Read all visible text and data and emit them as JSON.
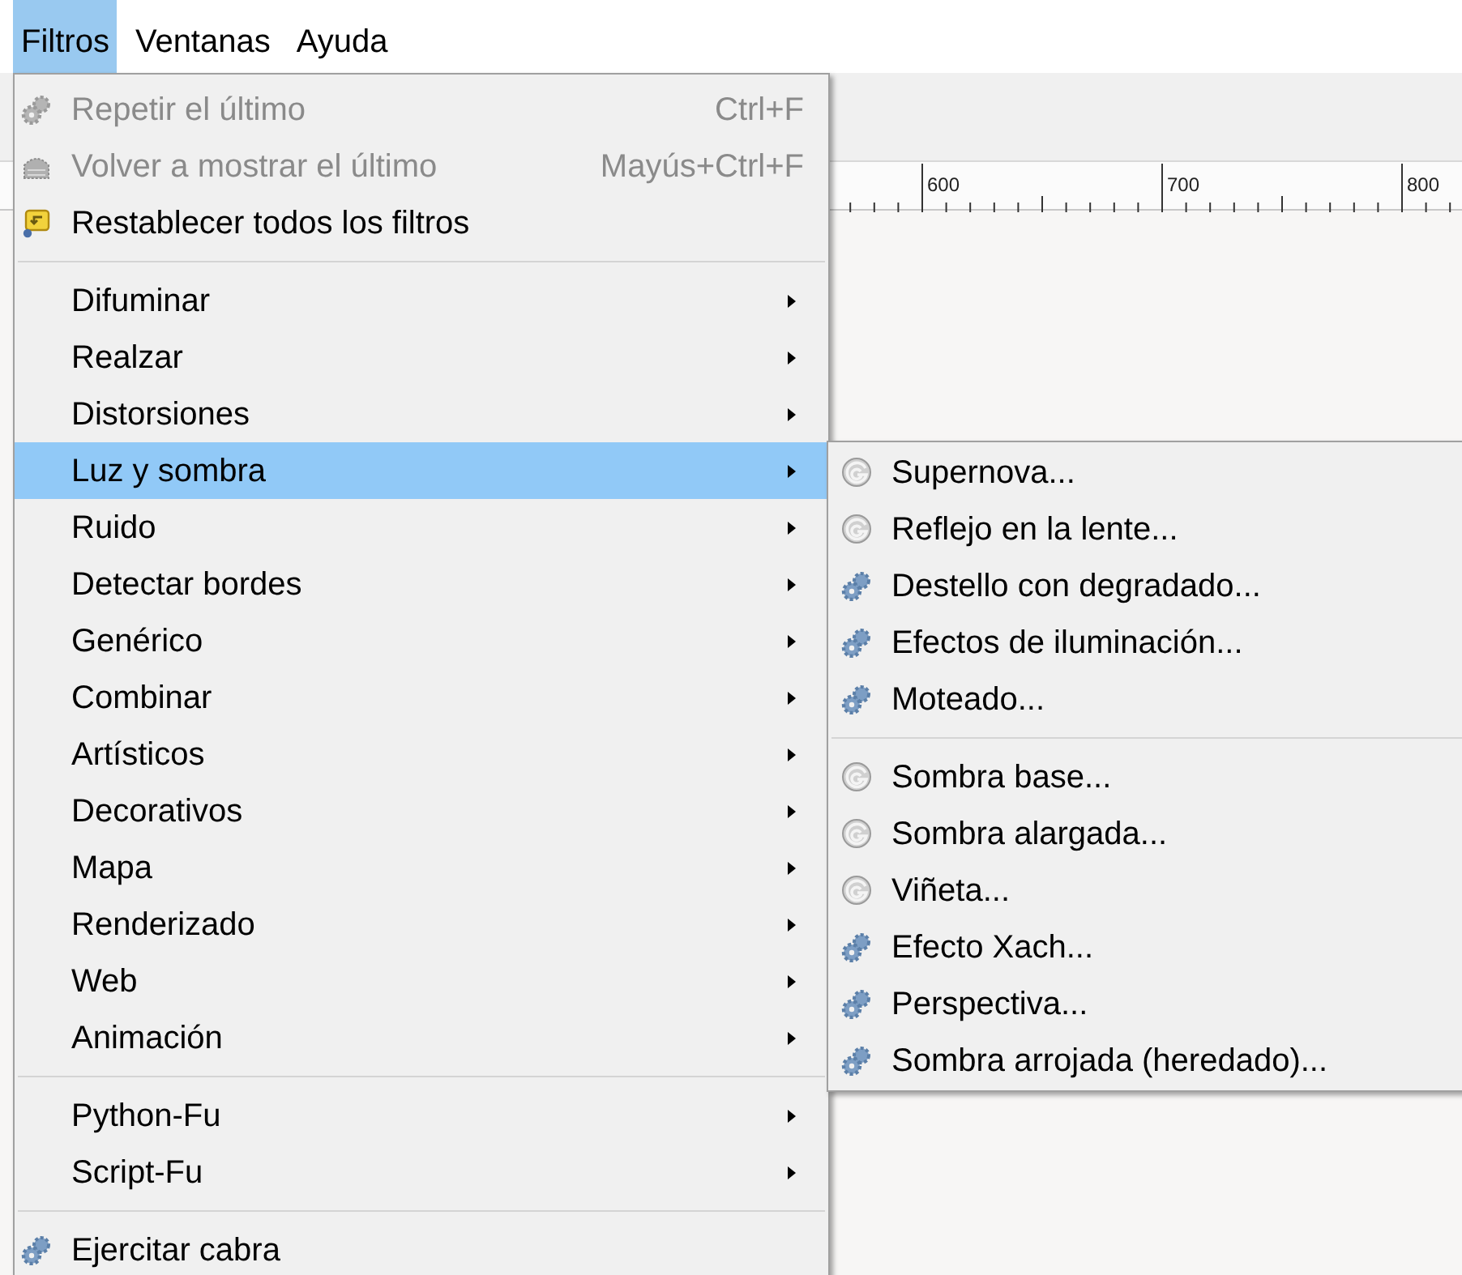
{
  "menubar": [
    {
      "label": "Filtros",
      "selected": true
    },
    {
      "label": "Ventanas",
      "selected": false
    },
    {
      "label": "Ayuda",
      "selected": false
    }
  ],
  "ruler": {
    "labels": [
      "600",
      "700",
      "800"
    ]
  },
  "main_menu": {
    "sections": [
      {
        "items": [
          {
            "label": "Repetir el último",
            "kind": "gear",
            "shortcut": "Ctrl+F",
            "disabled": true,
            "selected": false
          },
          {
            "label": "Volver a mostrar el último",
            "kind": "pattern",
            "shortcut": "Mayús+Ctrl+F",
            "disabled": true,
            "selected": false
          },
          {
            "label": "Restablecer todos los filtros",
            "kind": "reset",
            "disabled": false,
            "selected": false
          }
        ]
      },
      {
        "items": [
          {
            "label": "Difuminar",
            "kind": "submenu",
            "disabled": false,
            "selected": false
          },
          {
            "label": "Realzar",
            "kind": "submenu",
            "disabled": false,
            "selected": false
          },
          {
            "label": "Distorsiones",
            "kind": "submenu",
            "disabled": false,
            "selected": false
          },
          {
            "label": "Luz y sombra",
            "kind": "submenu",
            "disabled": false,
            "selected": true
          },
          {
            "label": "Ruido",
            "kind": "submenu",
            "disabled": false,
            "selected": false
          },
          {
            "label": "Detectar bordes",
            "kind": "submenu",
            "disabled": false,
            "selected": false
          },
          {
            "label": "Genérico",
            "kind": "submenu",
            "disabled": false,
            "selected": false
          },
          {
            "label": "Combinar",
            "kind": "submenu",
            "disabled": false,
            "selected": false
          },
          {
            "label": "Artísticos",
            "kind": "submenu",
            "disabled": false,
            "selected": false
          },
          {
            "label": "Decorativos",
            "kind": "submenu",
            "disabled": false,
            "selected": false
          },
          {
            "label": "Mapa",
            "kind": "submenu",
            "disabled": false,
            "selected": false
          },
          {
            "label": "Renderizado",
            "kind": "submenu",
            "disabled": false,
            "selected": false
          },
          {
            "label": "Web",
            "kind": "submenu",
            "disabled": false,
            "selected": false
          },
          {
            "label": "Animación",
            "kind": "submenu",
            "disabled": false,
            "selected": false
          }
        ]
      },
      {
        "items": [
          {
            "label": "Python-Fu",
            "kind": "submenu",
            "disabled": false,
            "selected": false
          },
          {
            "label": "Script-Fu",
            "kind": "submenu",
            "disabled": false,
            "selected": false
          }
        ]
      },
      {
        "items": [
          {
            "label": "Ejercitar cabra",
            "kind": "gear",
            "disabled": false,
            "selected": false
          }
        ]
      }
    ]
  },
  "submenu": {
    "sections": [
      {
        "items": [
          {
            "label": "Supernova...",
            "kind": "spiral"
          },
          {
            "label": "Reflejo en la lente...",
            "kind": "spiral"
          },
          {
            "label": "Destello con degradado...",
            "kind": "gear"
          },
          {
            "label": "Efectos de iluminación...",
            "kind": "gear"
          },
          {
            "label": "Moteado...",
            "kind": "gear"
          }
        ]
      },
      {
        "items": [
          {
            "label": "Sombra base...",
            "kind": "spiral"
          },
          {
            "label": "Sombra alargada...",
            "kind": "spiral"
          },
          {
            "label": "Viñeta...",
            "kind": "spiral"
          },
          {
            "label": "Efecto Xach...",
            "kind": "gear"
          },
          {
            "label": "Perspectiva...",
            "kind": "gear"
          },
          {
            "label": "Sombra arrojada (heredado)...",
            "kind": "gear"
          }
        ]
      }
    ]
  }
}
